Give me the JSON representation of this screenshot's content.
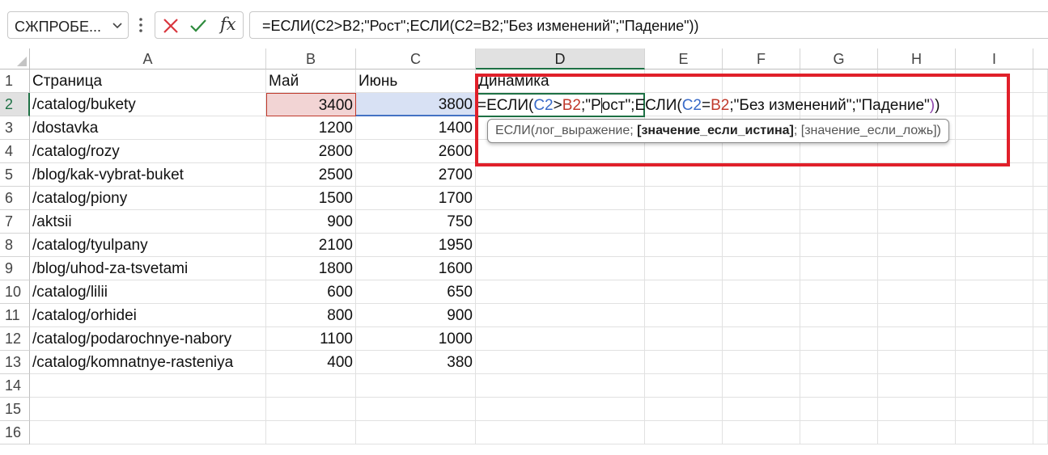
{
  "formula_bar": {
    "name_box": "СЖПРОБЕ...",
    "formula": "=ЕСЛИ(C2>B2;\"Рост\";ЕСЛИ(C2=B2;\"Без изменений\";\"Падение\"))",
    "fx": "fx"
  },
  "columns": [
    "A",
    "B",
    "C",
    "D",
    "E",
    "F",
    "G",
    "H",
    "I"
  ],
  "rows": [
    "1",
    "2",
    "3",
    "4",
    "5",
    "6",
    "7",
    "8",
    "9",
    "10",
    "11",
    "12",
    "13",
    "14",
    "15",
    "16"
  ],
  "headers": {
    "page": "Страница",
    "may": "Май",
    "june": "Июнь",
    "dynamics": "Динамика"
  },
  "data": [
    {
      "page": "/catalog/bukety",
      "may": "3400",
      "june": "3800"
    },
    {
      "page": "/dostavka",
      "may": "1200",
      "june": "1400"
    },
    {
      "page": "/catalog/rozy",
      "may": "2800",
      "june": "2600"
    },
    {
      "page": "/blog/kak-vybrat-buket",
      "may": "2500",
      "june": "2700"
    },
    {
      "page": "/catalog/piony",
      "may": "1500",
      "june": "1700"
    },
    {
      "page": "/aktsii",
      "may": "900",
      "june": "750"
    },
    {
      "page": "/catalog/tyulpany",
      "may": "2100",
      "june": "1950"
    },
    {
      "page": "/blog/uhod-za-tsvetami",
      "may": "1800",
      "june": "1600"
    },
    {
      "page": "/catalog/lilii",
      "may": "600",
      "june": "650"
    },
    {
      "page": "/catalog/orhidei",
      "may": "800",
      "june": "900"
    },
    {
      "page": "/catalog/podarochnye-nabory",
      "may": "1100",
      "june": "1000"
    },
    {
      "page": "/catalog/komnatnye-rasteniya",
      "may": "400",
      "june": "380"
    }
  ],
  "editing": {
    "p1": "=ЕСЛИ(",
    "ref_c": "C2",
    "op1": ">",
    "ref_b": "B2",
    "p2": ";\"Р",
    "p3": "ост\";ЕСЛИ(",
    "ref_c2": "C2",
    "op2": "=",
    "ref_b2": "B2",
    "p4": ";\"Без изменений\";\"Падение\"",
    "p5": ")",
    "p6": ")"
  },
  "tooltip": {
    "fn": "ЕСЛИ(лог_выражение; ",
    "bold": "[значение_если_истина]",
    "rest": "; [значение_если_ложь])"
  },
  "colors": {
    "highlight_box": "#e0202a",
    "active_green": "#1e7145"
  }
}
